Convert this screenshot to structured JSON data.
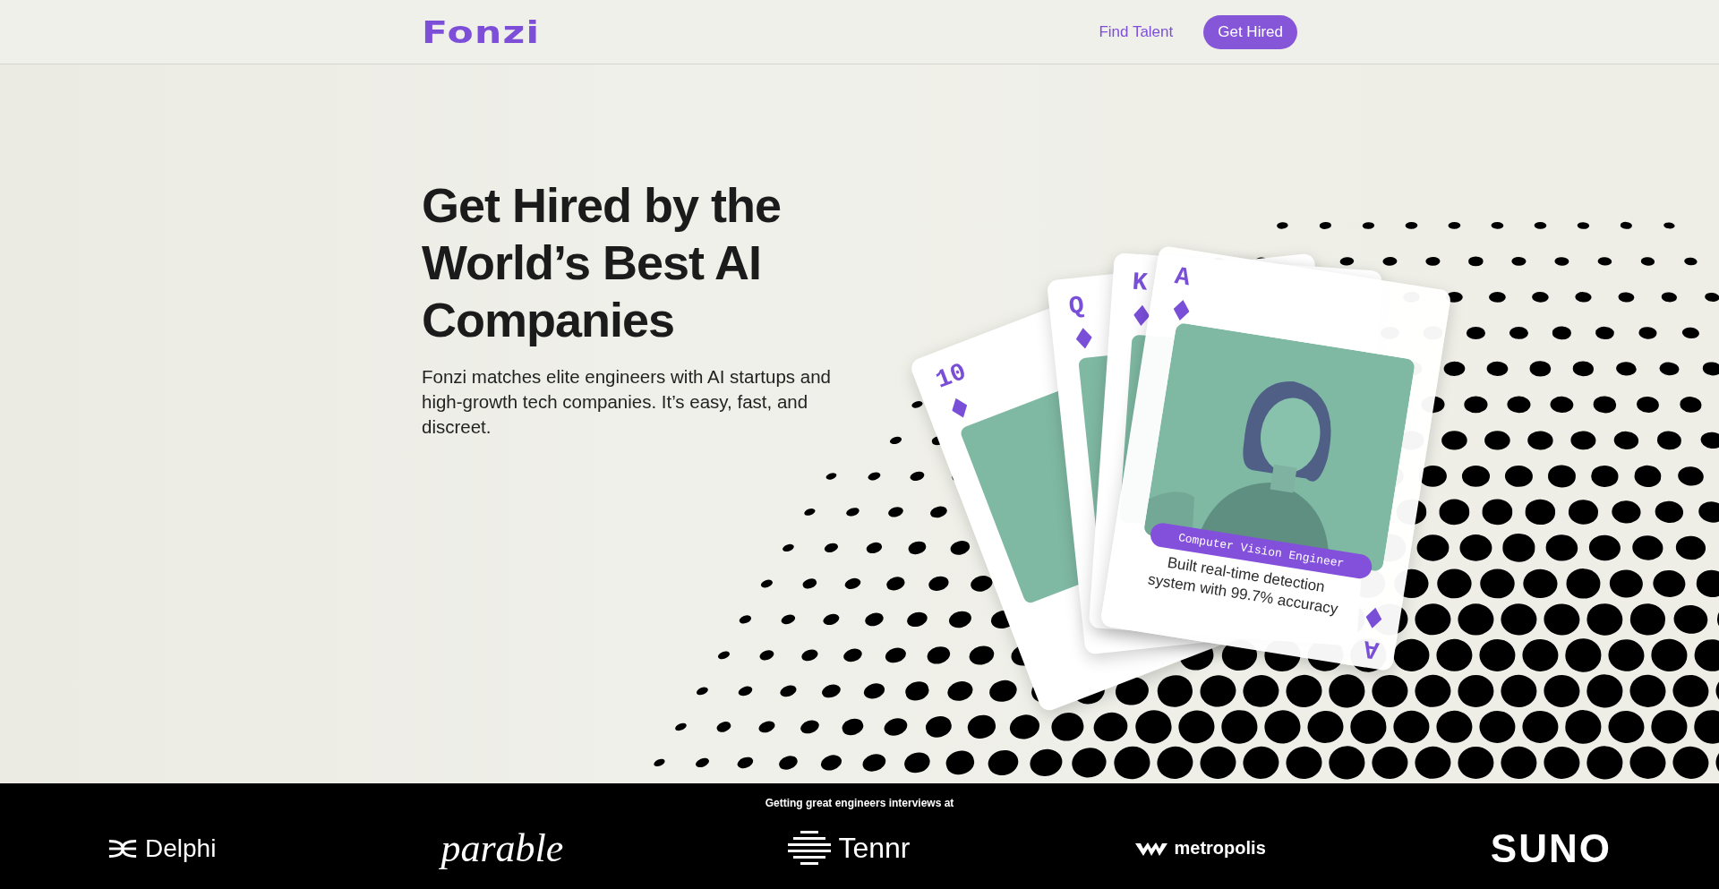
{
  "header": {
    "logo": "Fonzi",
    "nav": [
      {
        "label": "Find Talent",
        "kind": "link"
      },
      {
        "label": "Get Hired",
        "kind": "button"
      }
    ]
  },
  "hero": {
    "title": "Get Hired by the World’s Best AI Companies",
    "subtitle": "Fonzi matches elite engineers with AI startups and high-growth tech companies. It’s easy, fast, and discreet."
  },
  "cards": [
    {
      "rank": "10",
      "kind": "back"
    },
    {
      "rank": "Q",
      "kind": "back"
    },
    {
      "rank": "K",
      "kind": "back"
    },
    {
      "rank": "A",
      "kind": "front",
      "role": "Computer Vision Engineer",
      "achievement": "Built real-time detection system with 99.7% accuracy",
      "corner_rank": "A"
    }
  ],
  "logos_strip": {
    "caption": "Getting great engineers interviews at",
    "logos": [
      {
        "name": "Delphi",
        "kind": "delphi"
      },
      {
        "name": "parable",
        "kind": "parable"
      },
      {
        "name": "Tennr",
        "kind": "tennr"
      },
      {
        "name": "metropolis",
        "kind": "metropolis"
      },
      {
        "name": "SUNO",
        "kind": "suno"
      }
    ]
  }
}
